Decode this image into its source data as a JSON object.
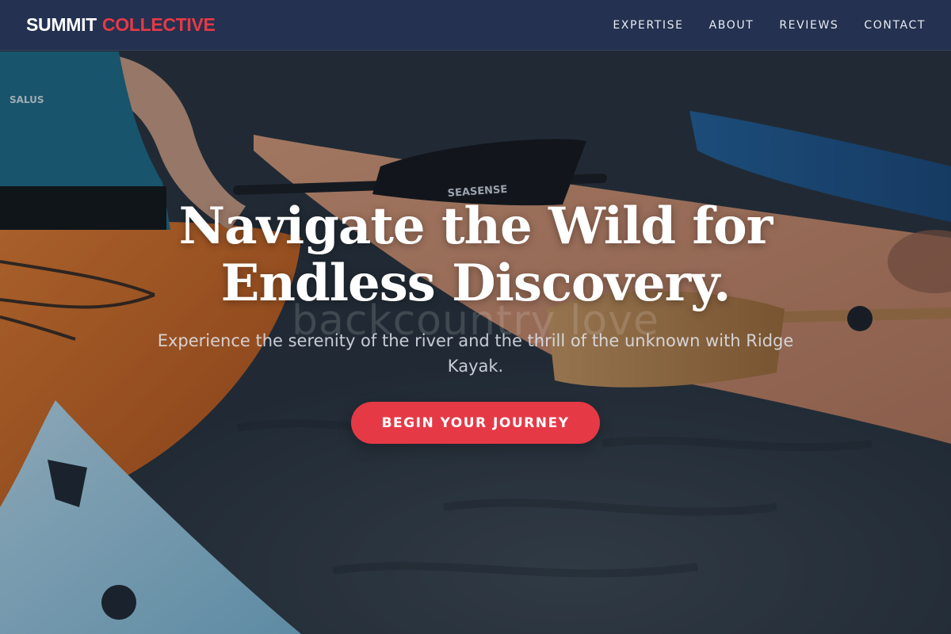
{
  "navbar": {
    "brand_primary": "SUMMIT",
    "brand_accent": "COLLECTIVE",
    "links": [
      "EXPERTISE",
      "ABOUT",
      "REVIEWS",
      "CONTACT"
    ]
  },
  "hero": {
    "title_line1": "Navigate the Wild for",
    "title_line2": "Endless Discovery.",
    "watermark": "backcountry love",
    "subtitle": "Experience the serenity of the river and the thrill of the unknown with Ridge Kayak.",
    "cta_label": "BEGIN YOUR JOURNEY",
    "vest_print": "SALUS",
    "paddle_print": "SEASENSE"
  },
  "colors": {
    "accent": "#e63946",
    "navbar": "#243252",
    "text_light": "#ffffff"
  }
}
